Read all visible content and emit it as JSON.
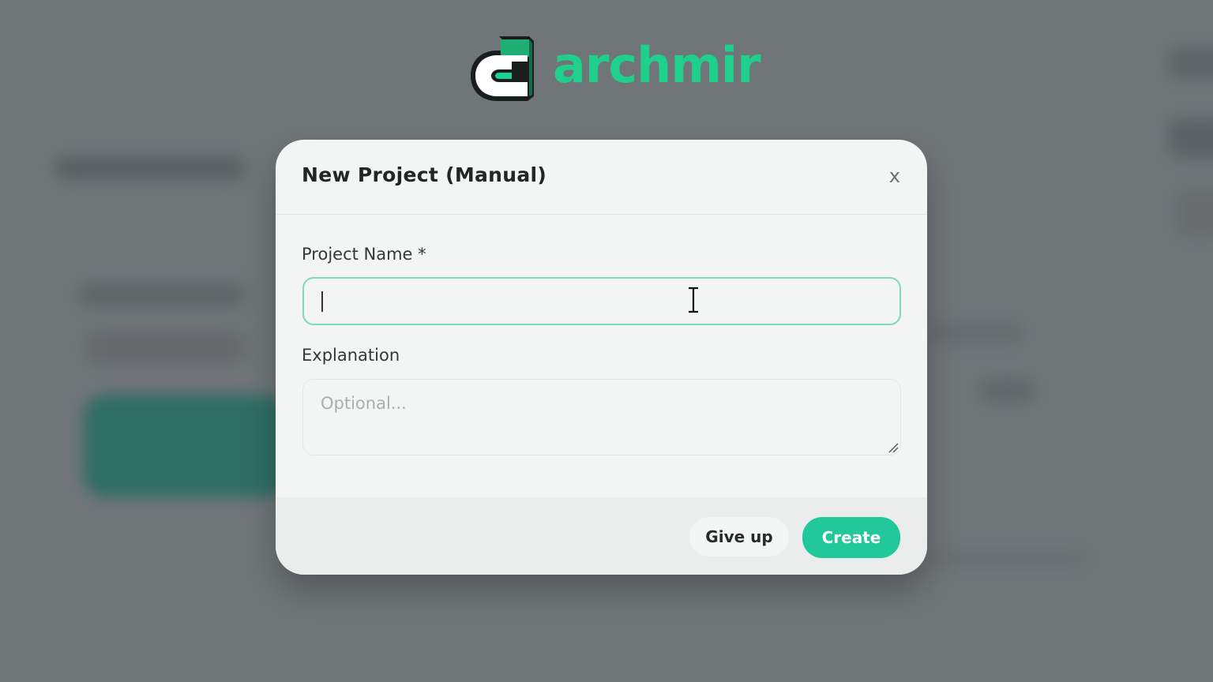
{
  "brand": {
    "name": "archmir",
    "accent_color": "#1fd08c",
    "logo_icon": "archmir-logo-icon"
  },
  "modal": {
    "title": "New Project (Manual)",
    "close_label": "x",
    "fields": {
      "project_name": {
        "label": "Project Name *",
        "value": "",
        "placeholder": ""
      },
      "explanation": {
        "label": "Explanation",
        "value": "",
        "placeholder": "Optional..."
      }
    },
    "buttons": {
      "give_up": "Give up",
      "create": "Create"
    },
    "create_button_color": "#21c89a",
    "focus_border_color": "#7fd9bb"
  },
  "cursor": {
    "type": "text-ibeam-icon"
  }
}
